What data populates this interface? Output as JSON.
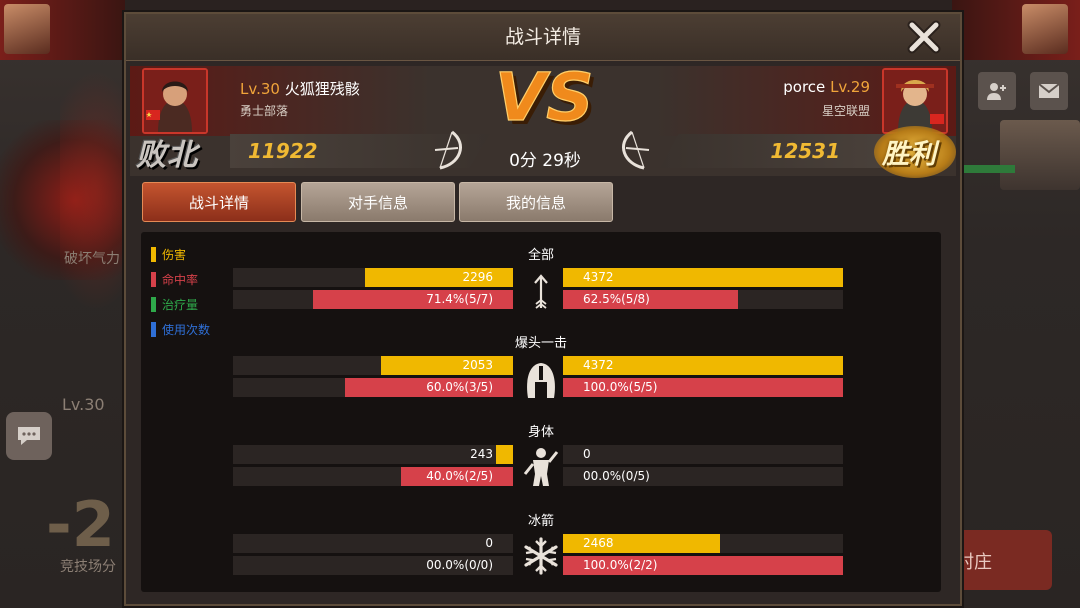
{
  "modal": {
    "title": "战斗详情",
    "battle_time": "0分 29秒",
    "vs_text": "VS"
  },
  "left_player": {
    "level": "Lv.30",
    "name": "火狐狸残骸",
    "guild": "勇士部落",
    "score": "11922",
    "result": "败北"
  },
  "right_player": {
    "level": "Lv.29",
    "name": "porce",
    "guild": "星空联盟",
    "score": "12531",
    "result": "胜利"
  },
  "tabs": [
    {
      "label": "战斗详情",
      "active": true
    },
    {
      "label": "对手信息",
      "active": false
    },
    {
      "label": "我的信息",
      "active": false
    }
  ],
  "legend": [
    {
      "label": "伤害",
      "color": "#f0b800"
    },
    {
      "label": "命中率",
      "color": "#d6414a"
    },
    {
      "label": "治疗量",
      "color": "#2ea84a"
    },
    {
      "label": "使用次数",
      "color": "#2f6fd6"
    }
  ],
  "sections": [
    {
      "title": "全部",
      "icon": "arrow-icon",
      "damage": {
        "left": "2296",
        "left_ratio": 0.53,
        "right": "4372",
        "right_ratio": 1.0
      },
      "hit": {
        "left": "71.4%(5/7)",
        "left_ratio": 0.714,
        "right": "62.5%(5/8)",
        "right_ratio": 0.625
      }
    },
    {
      "title": "爆头一击",
      "icon": "helmet-icon",
      "damage": {
        "left": "2053",
        "left_ratio": 0.47,
        "right": "4372",
        "right_ratio": 1.0
      },
      "hit": {
        "left": "60.0%(3/5)",
        "left_ratio": 0.6,
        "right": "100.0%(5/5)",
        "right_ratio": 1.0
      }
    },
    {
      "title": "身体",
      "icon": "body-icon",
      "damage": {
        "left": "243",
        "left_ratio": 0.06,
        "right": "0",
        "right_ratio": 0.0
      },
      "hit": {
        "left": "40.0%(2/5)",
        "left_ratio": 0.4,
        "right": "00.0%(0/5)",
        "right_ratio": 0.0
      }
    },
    {
      "title": "冰箭",
      "icon": "snowflake-icon",
      "damage": {
        "left": "0",
        "left_ratio": 0.0,
        "right": "2468",
        "right_ratio": 0.56
      },
      "hit": {
        "left": "00.0%(0/0)",
        "left_ratio": 0.0,
        "right": "100.0%(2/2)",
        "right_ratio": 1.0
      }
    }
  ],
  "background": {
    "left_level": "Lv.30",
    "left_label": "破坏气力",
    "big_number": "-2",
    "left_bottom_label": "竞技场分",
    "right_button_label": "村庄"
  }
}
